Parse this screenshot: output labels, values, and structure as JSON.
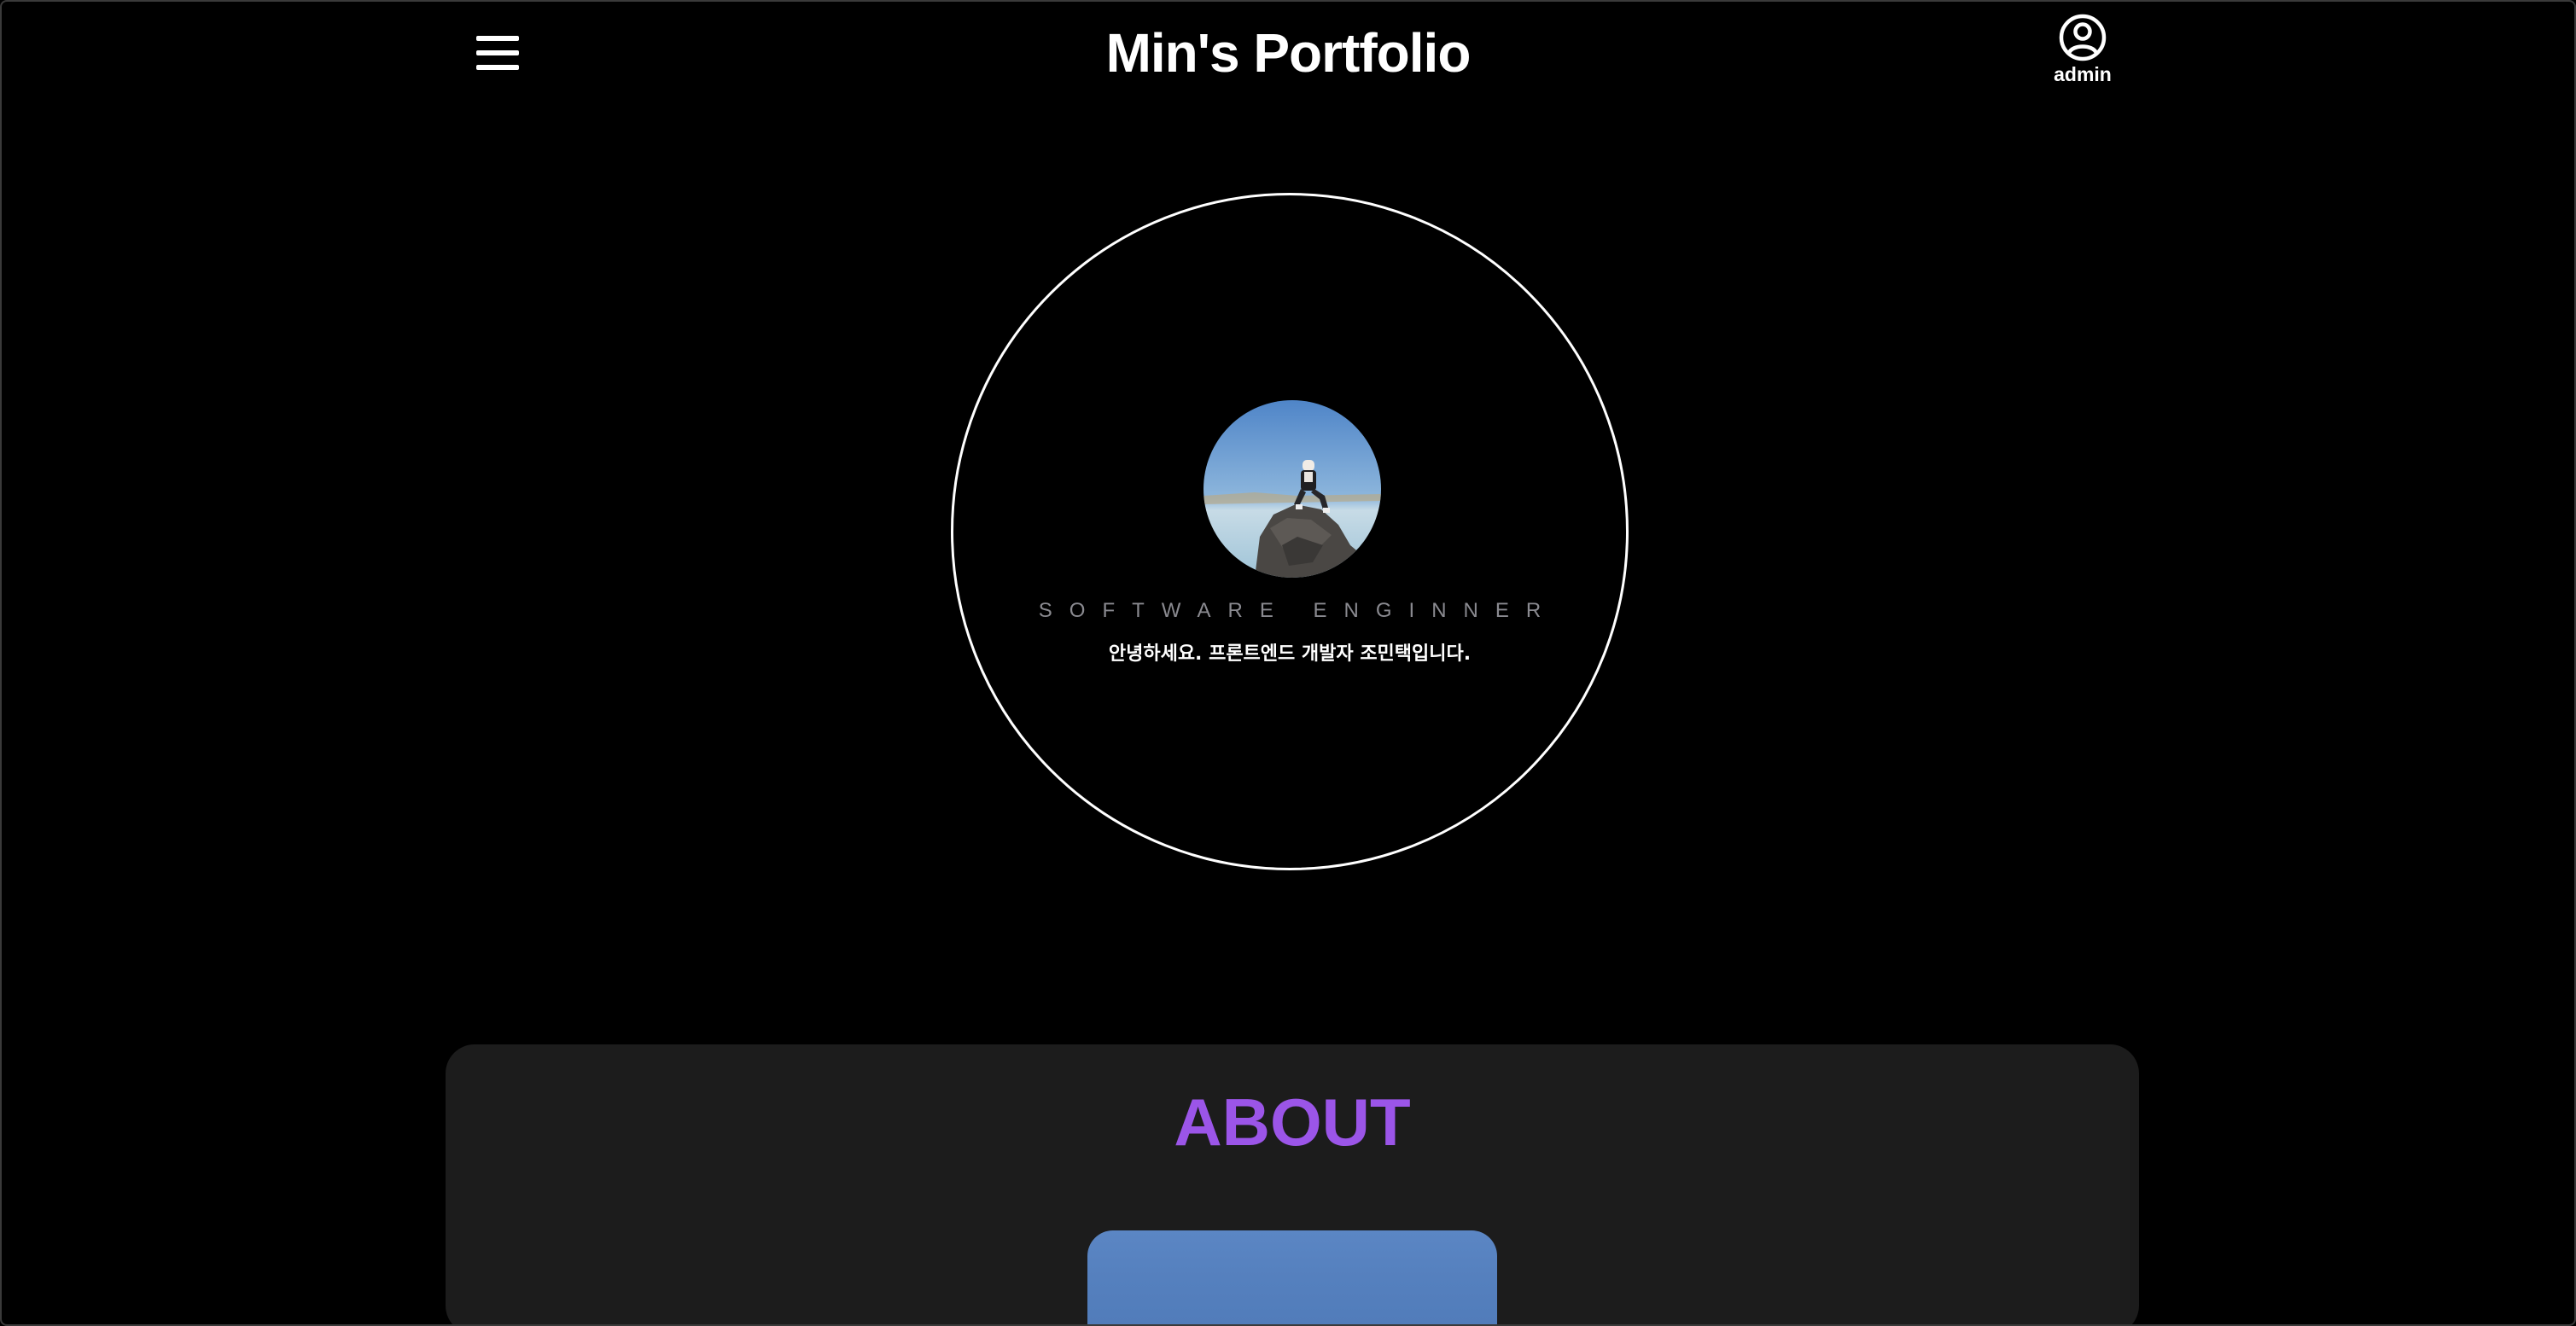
{
  "header": {
    "title": "Min's Portfolio",
    "menu_icon": "hamburger-icon",
    "user_icon": "user-circle-icon",
    "user_label": "admin"
  },
  "hero": {
    "job_title": "SOFTWARE ENGINNER",
    "greeting": "안녕하세요. 프론트엔드 개발자 조민택입니다."
  },
  "about": {
    "heading": "ABOUT"
  },
  "colors": {
    "background": "#000000",
    "section_background": "#1c1c1c",
    "accent": "#9b55e8",
    "job_title_text": "#8a8a90",
    "text": "#ffffff"
  }
}
